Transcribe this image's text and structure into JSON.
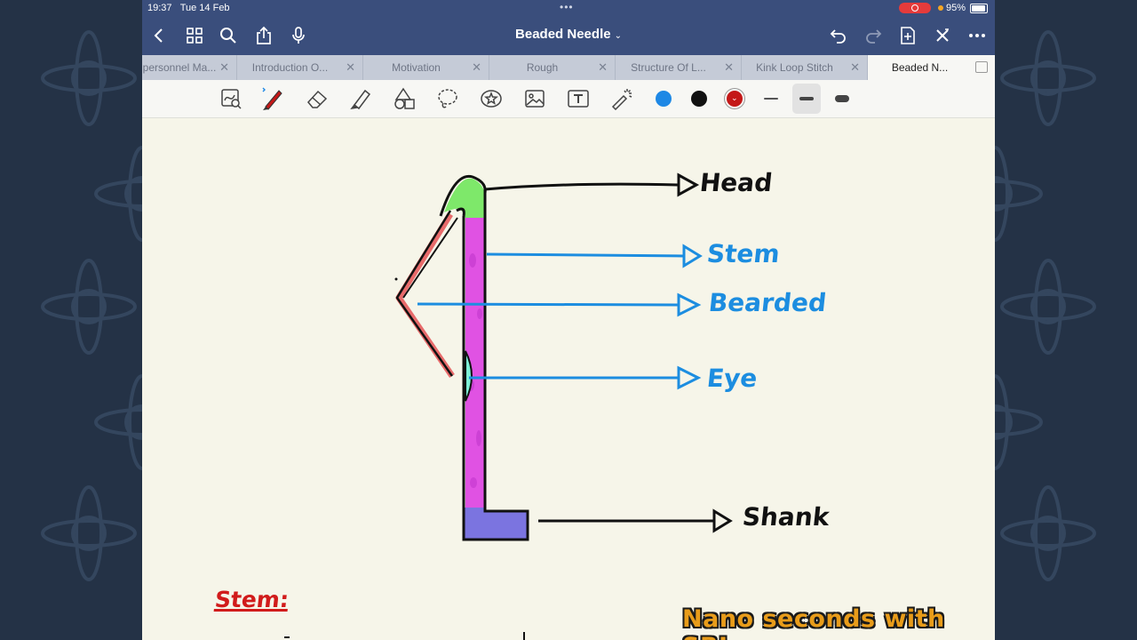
{
  "status_bar": {
    "time": "19:37",
    "date": "Tue 14 Feb",
    "battery": "95%"
  },
  "nav": {
    "title": "Beaded Needle",
    "buttons": [
      "back-icon",
      "grid-icon",
      "search-icon",
      "share-icon",
      "microphone-icon",
      "undo-icon",
      "redo-icon",
      "add-page-icon",
      "close-icon",
      "more-icon"
    ]
  },
  "tabs": [
    {
      "label": "personnel Ma..."
    },
    {
      "label": "Introduction O..."
    },
    {
      "label": "Motivation"
    },
    {
      "label": "Rough"
    },
    {
      "label": "Structure Of L..."
    },
    {
      "label": "Kink Loop Stitch"
    },
    {
      "label": "Beaded N...",
      "active": true
    }
  ],
  "toolbar": {
    "tools": [
      "lasso-image-icon",
      "pen-icon",
      "eraser-icon",
      "highlighter-icon",
      "shapes-icon",
      "lasso-icon",
      "sticker-icon",
      "image-icon",
      "text-icon",
      "laser-pointer-icon"
    ],
    "colors": [
      "#1e88e5",
      "#111111",
      "#c41818"
    ],
    "selected_color": "#c41818",
    "stroke_widths": [
      "thin",
      "medium",
      "thick"
    ],
    "selected_stroke": "medium"
  },
  "diagram": {
    "labels": {
      "head": "Head",
      "stem": "Stem",
      "bearded": "Bearded",
      "eye": "Eye",
      "shank": "Shank"
    },
    "colors": {
      "head": "#7ee86a",
      "stem": "#e052e3",
      "beard": "#e86b6b",
      "eye": "#7ef2d6",
      "shank": "#7b74e0",
      "pointer_blue": "#1c8de0"
    }
  },
  "notes": {
    "heading": "Stem:"
  },
  "watermark": "Nano seconds with SBJ"
}
